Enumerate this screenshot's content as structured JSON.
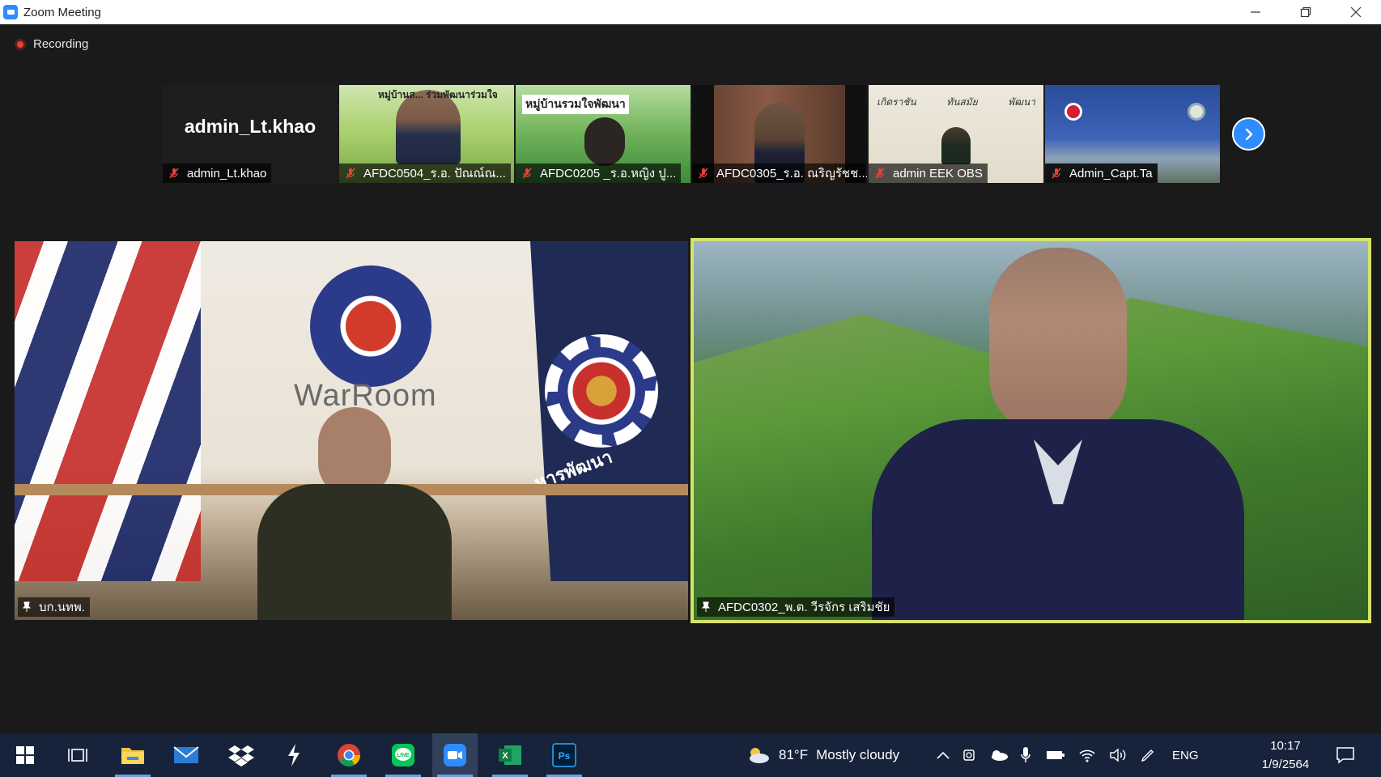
{
  "window": {
    "title": "Zoom Meeting",
    "controls": [
      "minimize",
      "restore",
      "close"
    ]
  },
  "recording": {
    "label": "Recording"
  },
  "thumbnails": [
    {
      "display_name": "admin_Lt.khao",
      "name": "admin_Lt.khao",
      "muted": true,
      "video_on": false
    },
    {
      "name": "AFDC0504_ร.อ. ปัณณ์ณ...",
      "muted": true,
      "video_on": true,
      "bg_text": "หมู่บ้านส... ร่วมพัฒนาร่วมใจ"
    },
    {
      "name": "AFDC0205 _ร.อ.หญิง ปู...",
      "muted": true,
      "video_on": true,
      "bg_text": "หมู่บ้านรวมใจพัฒนา"
    },
    {
      "name": "AFDC0305_ร.อ. ณริญรัชช...",
      "muted": true,
      "video_on": true
    },
    {
      "name": "admin EEK OBS",
      "muted": true,
      "video_on": true,
      "bg_text": [
        "เกิดราชัน",
        "ทันสมัย",
        "พัฒนา"
      ]
    },
    {
      "name": "Admin_Capt.Ta",
      "muted": true,
      "video_on": true
    }
  ],
  "strip_next_icon": "chevron-right-icon",
  "main_videos": [
    {
      "name": "บก.นทพ.",
      "pinned": true,
      "sign_text": "WarRoom",
      "flag_text": "หารพัฒนา"
    },
    {
      "name": "AFDC0302_พ.ต. วีรจักร  เสริมชัย",
      "pinned": true,
      "active_speaker": true
    }
  ],
  "taskbar": {
    "apps": [
      "windows-start-icon",
      "task-view-icon",
      "file-explorer-icon",
      "mail-icon",
      "dropbox-icon",
      "lightning-app-icon",
      "chrome-icon",
      "line-icon",
      "zoom-icon",
      "excel-icon",
      "photoshop-icon"
    ],
    "active_app": "zoom-icon",
    "weather": {
      "temp": "81°F",
      "condition": "Mostly cloudy"
    },
    "language": "ENG",
    "time": "10:17",
    "date": "1/9/2564"
  },
  "colors": {
    "zoom_blue": "#2d8cff",
    "active_speaker_border": "#d6e36a",
    "mic_muted": "#e8423b",
    "taskbar": "#16233a"
  }
}
